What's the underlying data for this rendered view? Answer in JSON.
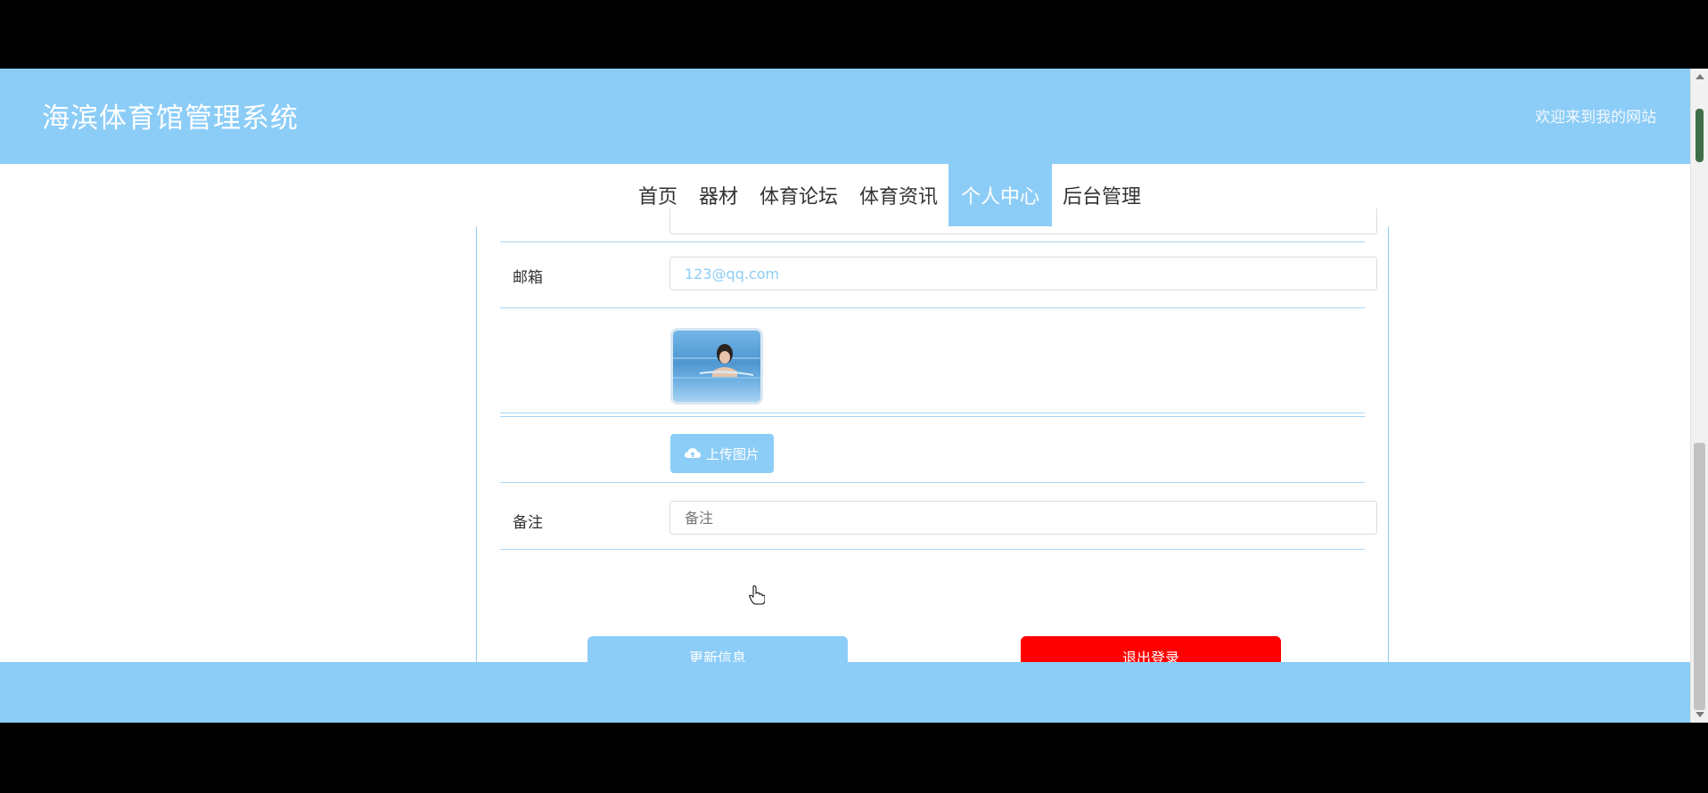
{
  "header": {
    "site_title": "海滨体育馆管理系统",
    "welcome_text": "欢迎来到我的网站"
  },
  "nav": {
    "items": [
      {
        "label": "首页"
      },
      {
        "label": "器材"
      },
      {
        "label": "体育论坛"
      },
      {
        "label": "体育资讯"
      },
      {
        "label": "个人中心",
        "active": true
      },
      {
        "label": "后台管理"
      }
    ]
  },
  "form": {
    "email_label": "邮箱",
    "email_value": "123@qq.com",
    "upload_label": "上传图片",
    "remark_label": "备注",
    "remark_placeholder": "备注"
  },
  "actions": {
    "update_label": "更新信息",
    "logout_label": "退出登录"
  },
  "colors": {
    "accent": "#8ccdf7",
    "danger": "#ff0000"
  }
}
